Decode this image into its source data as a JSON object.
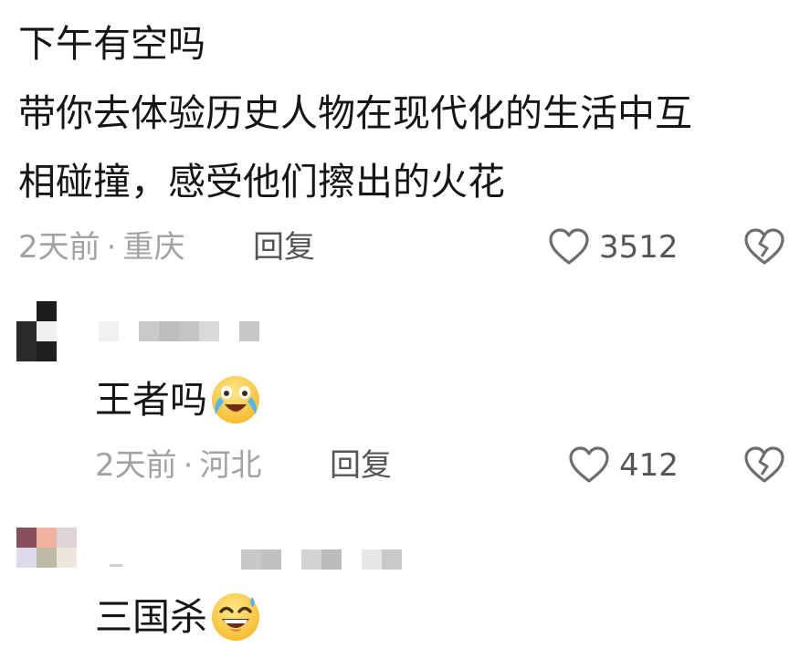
{
  "comments": [
    {
      "lines": [
        "下午有空吗",
        "带你去体验历史人物在现代化的生活中互",
        "相碰撞，感受他们擦出的火花"
      ],
      "time": "2天前",
      "separator": "·",
      "location": "重庆",
      "reply_label": "回复",
      "likes": "3512",
      "icons": {
        "like": "heart-outline-icon",
        "dislike": "broken-heart-icon"
      }
    },
    {
      "text": "王者吗",
      "emoji": "crying-laughing-face-emoji",
      "time": "2天前",
      "separator": "·",
      "location": "河北",
      "reply_label": "回复",
      "likes": "412",
      "icons": {
        "like": "heart-outline-icon",
        "dislike": "broken-heart-icon"
      }
    },
    {
      "text": "三国杀",
      "emoji": "grinning-sweat-face-emoji"
    }
  ],
  "colors": {
    "text": "#161616",
    "meta": "#a3a3a3",
    "action": "#555555",
    "background": "#ffffff"
  }
}
